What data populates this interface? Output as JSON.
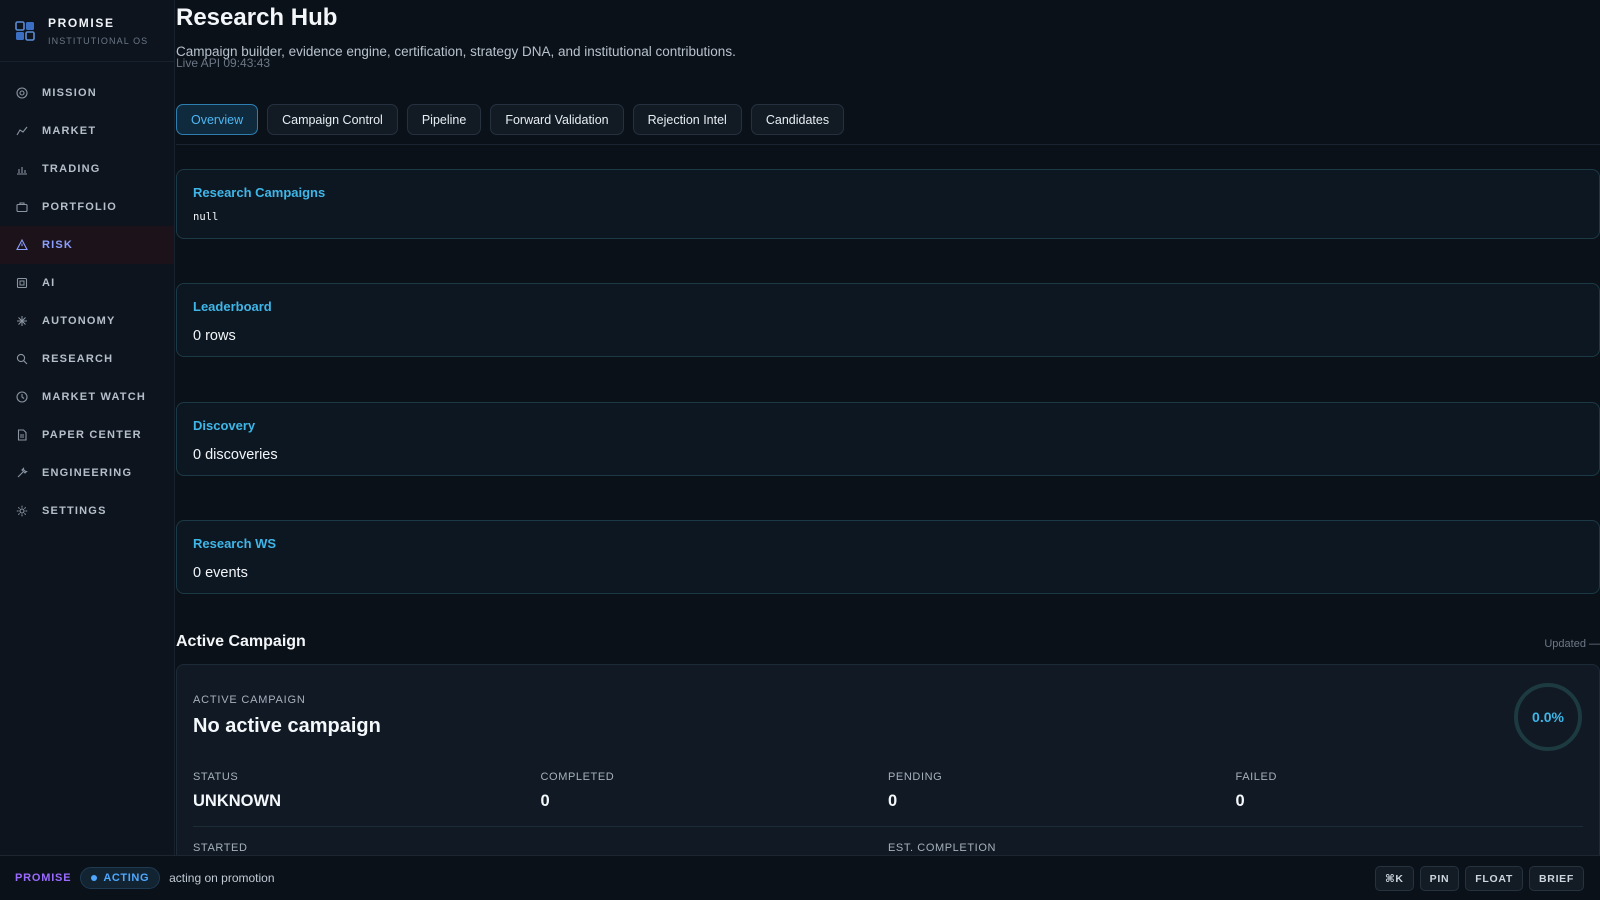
{
  "brand": {
    "name": "PROMISE",
    "subtitle": "INSTITUTIONAL OS"
  },
  "sidebar": {
    "items": [
      {
        "label": "MISSION",
        "icon": "target-icon"
      },
      {
        "label": "MARKET",
        "icon": "trend-line-icon"
      },
      {
        "label": "TRADING",
        "icon": "bar-chart-icon"
      },
      {
        "label": "PORTFOLIO",
        "icon": "briefcase-icon"
      },
      {
        "label": "RISK",
        "icon": "warning-triangle-icon",
        "active": true
      },
      {
        "label": "AI",
        "icon": "chip-icon"
      },
      {
        "label": "AUTONOMY",
        "icon": "spark-icon"
      },
      {
        "label": "RESEARCH",
        "icon": "search-icon"
      },
      {
        "label": "MARKET WATCH",
        "icon": "clock-icon"
      },
      {
        "label": "PAPER CENTER",
        "icon": "document-icon"
      },
      {
        "label": "ENGINEERING",
        "icon": "wrench-icon"
      },
      {
        "label": "SETTINGS",
        "icon": "gear-icon"
      }
    ]
  },
  "header": {
    "title": "Research Hub",
    "subtitle": "Campaign builder, evidence engine, certification, strategy DNA, and institutional contributions.",
    "live_api": "Live API 09:43:43"
  },
  "tabs": [
    {
      "label": "Overview",
      "active": true
    },
    {
      "label": "Campaign Control"
    },
    {
      "label": "Pipeline"
    },
    {
      "label": "Forward Validation"
    },
    {
      "label": "Rejection Intel"
    },
    {
      "label": "Candidates"
    }
  ],
  "cards": {
    "campaigns": {
      "title": "Research Campaigns",
      "value": "null"
    },
    "leaderboard": {
      "title": "Leaderboard",
      "value": "0 rows"
    },
    "discovery": {
      "title": "Discovery",
      "value": "0 discoveries"
    },
    "ws": {
      "title": "Research WS",
      "value": "0 events"
    }
  },
  "active_campaign": {
    "section_title": "Active Campaign",
    "updated": "Updated —",
    "eyebrow": "ACTIVE CAMPAIGN",
    "headline": "No active campaign",
    "progress_label": "0.0%",
    "progress_fraction": 0.0,
    "stats": [
      {
        "label": "STATUS",
        "value": "UNKNOWN"
      },
      {
        "label": "COMPLETED",
        "value": "0"
      },
      {
        "label": "PENDING",
        "value": "0"
      },
      {
        "label": "FAILED",
        "value": "0"
      }
    ],
    "date_labels": {
      "started": "STARTED",
      "est_completion": "EST. COMPLETION"
    }
  },
  "bottom_bar": {
    "brand": "PROMISE",
    "status": "ACTING",
    "message": "acting on promotion",
    "actions": [
      "⌘K",
      "PIN",
      "FLOAT",
      "BRIEF"
    ]
  },
  "colors": {
    "accent": "#3fb6e8",
    "brand_purple": "#9a6bff",
    "active_nav": "#8aa0ff",
    "status_blue": "#4fa8ff"
  }
}
